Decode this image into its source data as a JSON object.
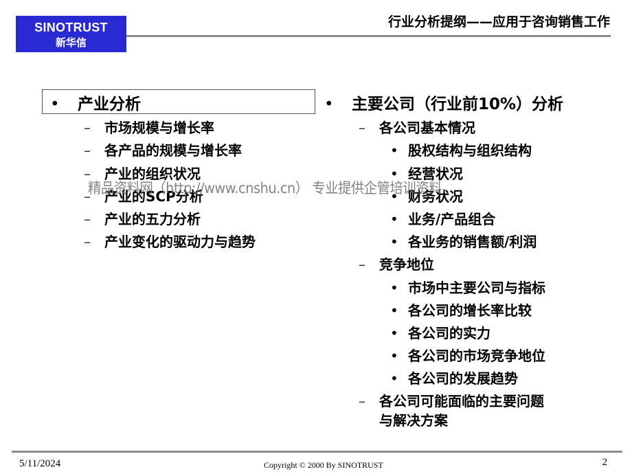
{
  "logo": {
    "en": "SINOTRUST",
    "zh": "新华信",
    "bg_color": "#2a2ad2"
  },
  "header": {
    "title": "行业分析提纲——应用于咨询销售工作"
  },
  "left_column": {
    "topic": {
      "marker": "•",
      "label": "产业分析"
    },
    "subitems": [
      {
        "marker": "–",
        "label": "市场规模与增长率"
      },
      {
        "marker": "–",
        "label": "各产品的规模与增长率"
      },
      {
        "marker": "–",
        "label": "产业的组织状况"
      },
      {
        "marker": "–",
        "label": "产业的SCP分析"
      },
      {
        "marker": "–",
        "label": "产业的五力分析"
      },
      {
        "marker": "–",
        "label": "产业变化的驱动力与趋势"
      }
    ]
  },
  "right_column": {
    "topic": {
      "marker": "•",
      "label": "主要公司（行业前10%）分析"
    },
    "sections": [
      {
        "marker": "–",
        "label": "各公司基本情况",
        "items": [
          {
            "marker": "•",
            "label": "股权结构与组织结构"
          },
          {
            "marker": "•",
            "label": "经营状况"
          },
          {
            "marker": "•",
            "label": "财务状况"
          },
          {
            "marker": "•",
            "label": "业务/产品组合"
          },
          {
            "marker": "•",
            "label": "各业务的销售额/利润"
          }
        ]
      },
      {
        "marker": "–",
        "label": "竞争地位",
        "items": [
          {
            "marker": "•",
            "label": "市场中主要公司与指标"
          },
          {
            "marker": "•",
            "label": "各公司的增长率比较"
          },
          {
            "marker": "•",
            "label": "各公司的实力"
          },
          {
            "marker": "•",
            "label": "各公司的市场竞争地位"
          },
          {
            "marker": "•",
            "label": "各公司的发展趋势"
          }
        ]
      },
      {
        "marker": "–",
        "label_line1": "各公司可能面临的主要问题",
        "label_line2": "与解决方案"
      }
    ]
  },
  "watermark": "精品资料网（http://www.cnshu.cn） 专业提供企管培训资料",
  "footer": {
    "date": "5/11/2024",
    "copyright": "Copyright © 2000 By SINOTRUST",
    "page": "2"
  }
}
